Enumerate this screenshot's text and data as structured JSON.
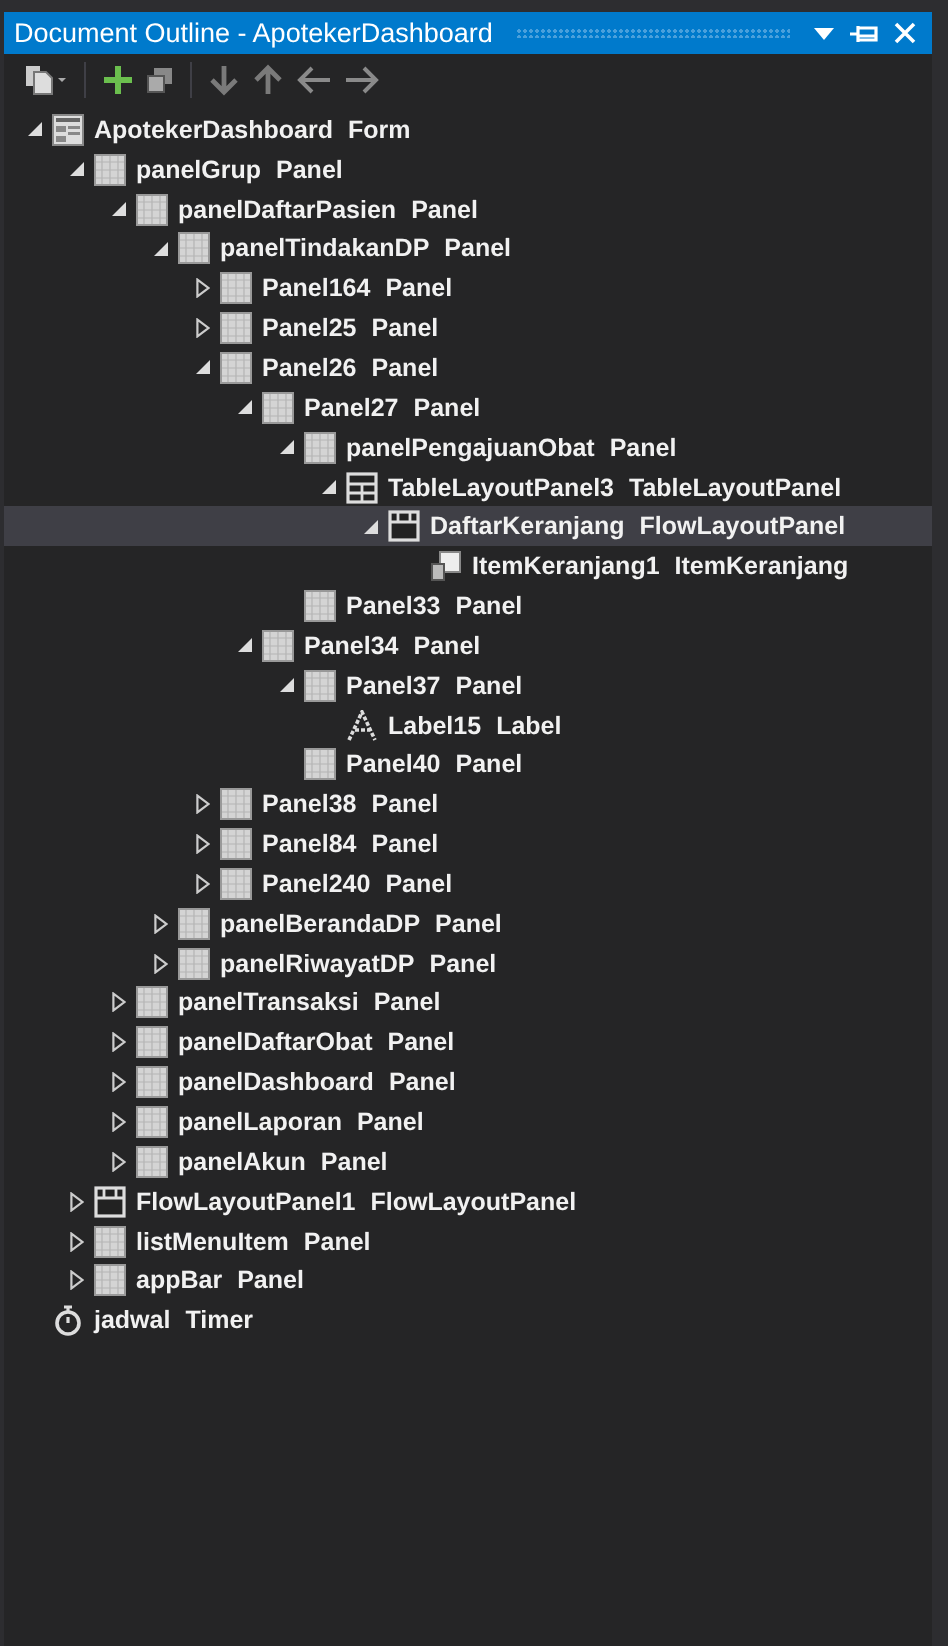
{
  "window": {
    "title": "Document Outline - ApotekerDashboard"
  },
  "tree": [
    {
      "name": "ApotekerDashboard",
      "type": "Form",
      "kind": "form",
      "expanded": true,
      "selected": false,
      "children": [
        {
          "name": "panelGrup",
          "type": "Panel",
          "kind": "panel",
          "expanded": true,
          "selected": false,
          "children": [
            {
              "name": "panelDaftarPasien",
              "type": "Panel",
              "kind": "panel",
              "expanded": true,
              "selected": false,
              "children": [
                {
                  "name": "panelTindakanDP",
                  "type": "Panel",
                  "kind": "panel",
                  "expanded": true,
                  "selected": false,
                  "children": [
                    {
                      "name": "Panel164",
                      "type": "Panel",
                      "kind": "panel",
                      "expanded": false,
                      "selected": false
                    },
                    {
                      "name": "Panel25",
                      "type": "Panel",
                      "kind": "panel",
                      "expanded": false,
                      "selected": false
                    },
                    {
                      "name": "Panel26",
                      "type": "Panel",
                      "kind": "panel",
                      "expanded": true,
                      "selected": false,
                      "children": [
                        {
                          "name": "Panel27",
                          "type": "Panel",
                          "kind": "panel",
                          "expanded": true,
                          "selected": false,
                          "children": [
                            {
                              "name": "panelPengajuanObat",
                              "type": "Panel",
                              "kind": "panel",
                              "expanded": true,
                              "selected": false,
                              "children": [
                                {
                                  "name": "TableLayoutPanel3",
                                  "type": "TableLayoutPanel",
                                  "kind": "table",
                                  "expanded": true,
                                  "selected": false,
                                  "children": [
                                    {
                                      "name": "DaftarKeranjang",
                                      "type": "FlowLayoutPanel",
                                      "kind": "flow",
                                      "expanded": true,
                                      "selected": true,
                                      "children": [
                                        {
                                          "name": "ItemKeranjang1",
                                          "type": "ItemKeranjang",
                                          "kind": "usercontrol",
                                          "selected": false
                                        }
                                      ]
                                    }
                                  ]
                                }
                              ]
                            },
                            {
                              "name": "Panel33",
                              "type": "Panel",
                              "kind": "panel",
                              "selected": false
                            }
                          ]
                        },
                        {
                          "name": "Panel34",
                          "type": "Panel",
                          "kind": "panel",
                          "expanded": true,
                          "selected": false,
                          "children": [
                            {
                              "name": "Panel37",
                              "type": "Panel",
                              "kind": "panel",
                              "expanded": true,
                              "selected": false,
                              "children": [
                                {
                                  "name": "Label15",
                                  "type": "Label",
                                  "kind": "label",
                                  "selected": false
                                }
                              ]
                            },
                            {
                              "name": "Panel40",
                              "type": "Panel",
                              "kind": "panel",
                              "selected": false
                            }
                          ]
                        }
                      ]
                    },
                    {
                      "name": "Panel38",
                      "type": "Panel",
                      "kind": "panel",
                      "expanded": false,
                      "selected": false
                    },
                    {
                      "name": "Panel84",
                      "type": "Panel",
                      "kind": "panel",
                      "expanded": false,
                      "selected": false
                    },
                    {
                      "name": "Panel240",
                      "type": "Panel",
                      "kind": "panel",
                      "expanded": false,
                      "selected": false
                    }
                  ]
                },
                {
                  "name": "panelBerandaDP",
                  "type": "Panel",
                  "kind": "panel",
                  "expanded": false,
                  "selected": false
                },
                {
                  "name": "panelRiwayatDP",
                  "type": "Panel",
                  "kind": "panel",
                  "expanded": false,
                  "selected": false
                }
              ]
            },
            {
              "name": "panelTransaksi",
              "type": "Panel",
              "kind": "panel",
              "expanded": false,
              "selected": false
            },
            {
              "name": "panelDaftarObat",
              "type": "Panel",
              "kind": "panel",
              "expanded": false,
              "selected": false
            },
            {
              "name": "panelDashboard",
              "type": "Panel",
              "kind": "panel",
              "expanded": false,
              "selected": false
            },
            {
              "name": "panelLaporan",
              "type": "Panel",
              "kind": "panel",
              "expanded": false,
              "selected": false
            },
            {
              "name": "panelAkun",
              "type": "Panel",
              "kind": "panel",
              "expanded": false,
              "selected": false
            }
          ]
        },
        {
          "name": "FlowLayoutPanel1",
          "type": "FlowLayoutPanel",
          "kind": "flow",
          "expanded": false,
          "selected": false
        },
        {
          "name": "listMenuItem",
          "type": "Panel",
          "kind": "panel",
          "expanded": false,
          "selected": false
        },
        {
          "name": "appBar",
          "type": "Panel",
          "kind": "panel",
          "expanded": false,
          "selected": false
        }
      ]
    },
    {
      "name": "jadwal",
      "type": "Timer",
      "kind": "timer",
      "selected": false
    }
  ]
}
